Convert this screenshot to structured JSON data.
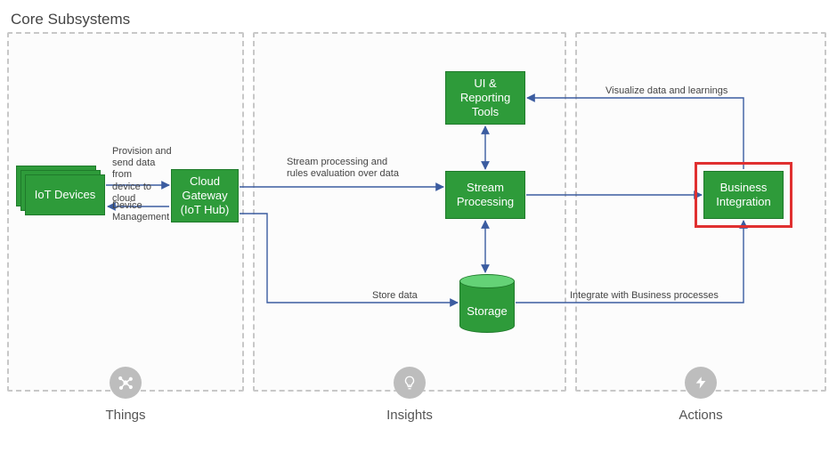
{
  "title": "Core Subsystems",
  "columns": {
    "things": {
      "label": "Things"
    },
    "insights": {
      "label": "Insights"
    },
    "actions": {
      "label": "Actions"
    }
  },
  "nodes": {
    "iot_devices": "IoT Devices",
    "cloud_gateway": "Cloud\nGateway\n(IoT Hub)",
    "ui_reporting": "UI &\nReporting\nTools",
    "stream_processing": "Stream\nProcessing",
    "business_integration": "Business\nIntegration",
    "storage": "Storage"
  },
  "edges": {
    "provision": "Provision and\nsend data from\ndevice to cloud",
    "device_mgmt": "Device\nManagement",
    "stream_rules": "Stream processing and\nrules evaluation over data",
    "store_data": "Store data",
    "visualize": "Visualize data and learnings",
    "integrate": "Integrate with Business processes"
  },
  "icons": {
    "things": "network-icon",
    "insights": "lightbulb-icon",
    "actions": "lightning-icon"
  },
  "colors": {
    "box_fill": "#2E9B3A",
    "line": "#3b5ca0",
    "highlight": "#e03030"
  }
}
